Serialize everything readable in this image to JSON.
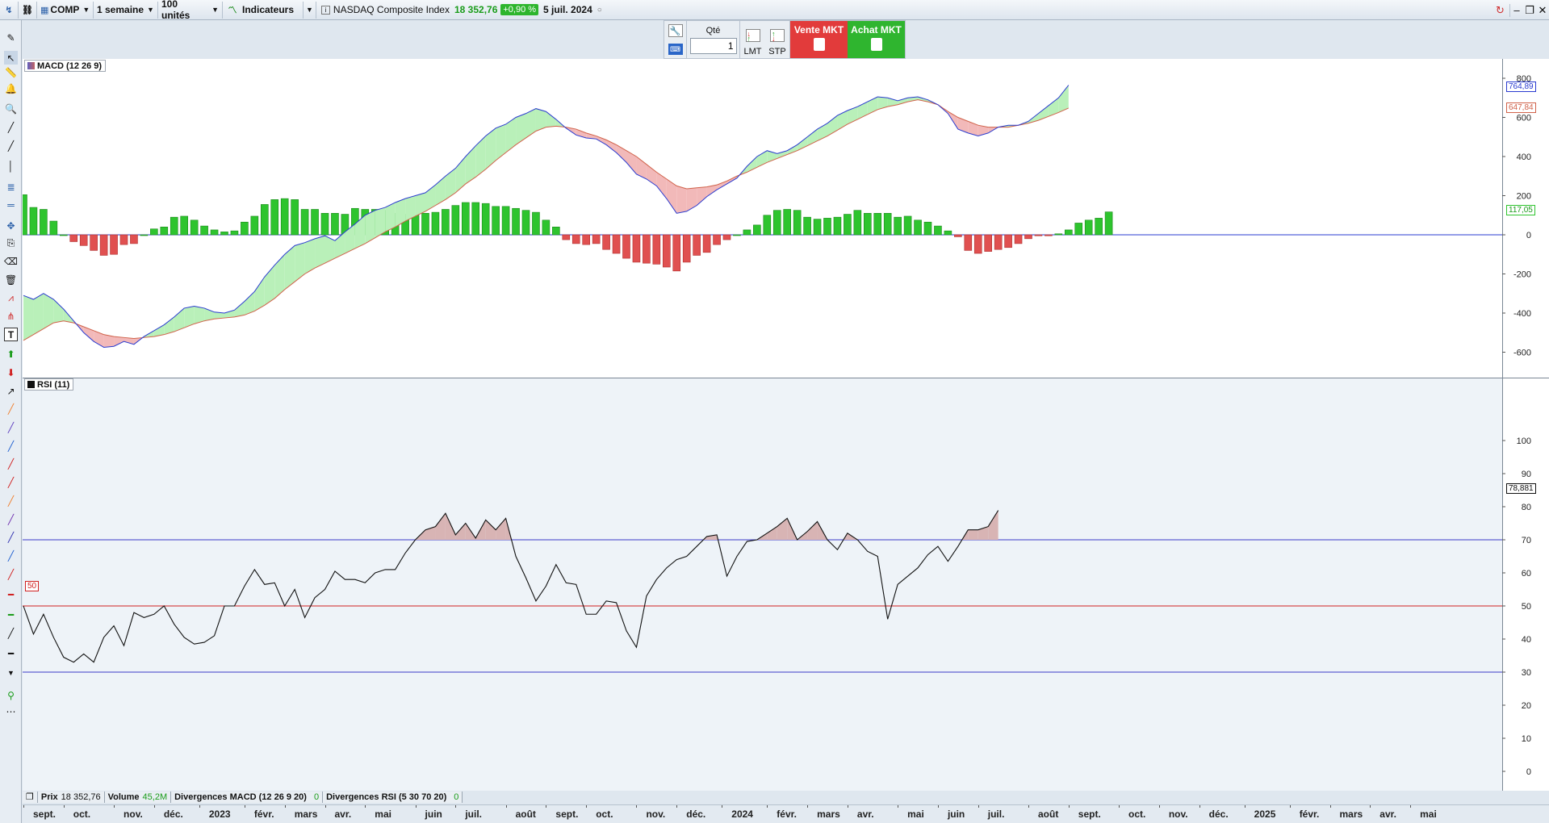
{
  "topbar": {
    "symbol": "COMP",
    "period": "1 semaine",
    "units": "100 unités",
    "indicators": "Indicateurs",
    "instrument": "NASDAQ Composite Index",
    "price": "18 352,76",
    "change": "+0,90 %",
    "date": "5 juil. 2024"
  },
  "trade": {
    "qty_label": "Qté",
    "qty_value": "1",
    "lmt": "LMT",
    "stp": "STP",
    "sell": "Vente MKT",
    "buy": "Achat MKT"
  },
  "colors": {
    "macd_line": "#2a3bd0",
    "signal_line": "#d0624a",
    "hist_pos": "#2ec42e",
    "hist_neg": "#e05050",
    "fill_pos": "#b9f0b9",
    "fill_neg": "#f2b9b9",
    "rsi_line": "#111111",
    "rsi_fill": "#d8b4b4"
  },
  "macd_panel": {
    "label": "MACD (12 26 9)",
    "macd_last": "764,89",
    "signal_last": "647,84",
    "hist_last": "117,05",
    "y_ticks": [
      "800",
      "600",
      "400",
      "200",
      "0",
      "-200",
      "-400",
      "-600"
    ],
    "y_tick_values": [
      800,
      600,
      400,
      200,
      0,
      -200,
      -400,
      -600
    ],
    "ylim": [
      -700,
      830
    ]
  },
  "rsi_panel": {
    "label": "RSI (11)",
    "rsi_last": "78,881",
    "level_50": "50",
    "y_ticks": [
      "100",
      "90",
      "80",
      "70",
      "60",
      "50",
      "40",
      "30",
      "20",
      "10",
      "0"
    ],
    "y_tick_values": [
      100,
      90,
      80,
      70,
      60,
      50,
      40,
      30,
      20,
      10,
      0
    ],
    "ylim": [
      -3,
      110
    ]
  },
  "legend": [
    {
      "label": "Prix",
      "value": "18 352,76"
    },
    {
      "label": "Volume",
      "value": "45,2M"
    },
    {
      "label": "Divergences MACD (12 26 9 20)",
      "value": "0"
    },
    {
      "label": "Divergences RSI (5 30 70 20)",
      "value": "0"
    }
  ],
  "time_axis": [
    {
      "label": "sept.",
      "x": 0
    },
    {
      "label": "oct.",
      "x": 4
    },
    {
      "label": "nov.",
      "x": 9
    },
    {
      "label": "déc.",
      "x": 13
    },
    {
      "label": "2023",
      "x": 17.5
    },
    {
      "label": "févr.",
      "x": 22
    },
    {
      "label": "mars",
      "x": 26
    },
    {
      "label": "avr.",
      "x": 30
    },
    {
      "label": "mai",
      "x": 34
    },
    {
      "label": "juin",
      "x": 39
    },
    {
      "label": "juil.",
      "x": 43
    },
    {
      "label": "août",
      "x": 48
    },
    {
      "label": "sept.",
      "x": 52
    },
    {
      "label": "oct.",
      "x": 56
    },
    {
      "label": "nov.",
      "x": 61
    },
    {
      "label": "déc.",
      "x": 65
    },
    {
      "label": "2024",
      "x": 69.5
    },
    {
      "label": "févr.",
      "x": 74
    },
    {
      "label": "mars",
      "x": 78
    },
    {
      "label": "avr.",
      "x": 82
    },
    {
      "label": "mai",
      "x": 87
    },
    {
      "label": "juin",
      "x": 91
    },
    {
      "label": "juil.",
      "x": 95
    },
    {
      "label": "août",
      "x": 100
    },
    {
      "label": "sept.",
      "x": 104
    },
    {
      "label": "oct.",
      "x": 109
    },
    {
      "label": "nov.",
      "x": 113
    },
    {
      "label": "déc.",
      "x": 117
    },
    {
      "label": "2025",
      "x": 121.5
    },
    {
      "label": "févr.",
      "x": 126
    },
    {
      "label": "mars",
      "x": 130
    },
    {
      "label": "avr.",
      "x": 134
    },
    {
      "label": "mai",
      "x": 138
    }
  ],
  "chart_data": [
    {
      "type": "line",
      "title": "MACD (12 26 9)",
      "ylim": [
        -700,
        830
      ],
      "x_unit": "weeks",
      "series": [
        {
          "name": "MACD",
          "values": [
            -310,
            -330,
            -300,
            -330,
            -380,
            -440,
            -500,
            -545,
            -575,
            -570,
            -545,
            -560,
            -520,
            -490,
            -460,
            -420,
            -375,
            -365,
            -375,
            -395,
            -400,
            -385,
            -340,
            -290,
            -215,
            -155,
            -100,
            -55,
            -40,
            -20,
            -5,
            -30,
            15,
            55,
            100,
            125,
            140,
            165,
            185,
            200,
            215,
            255,
            300,
            340,
            400,
            455,
            505,
            545,
            565,
            600,
            620,
            645,
            630,
            590,
            545,
            510,
            495,
            490,
            460,
            420,
            370,
            310,
            285,
            250,
            185,
            110,
            120,
            150,
            195,
            230,
            260,
            290,
            350,
            400,
            430,
            415,
            430,
            460,
            500,
            540,
            570,
            610,
            635,
            655,
            680,
            705,
            700,
            685,
            700,
            705,
            690,
            665,
            620,
            540,
            520,
            505,
            520,
            550,
            560,
            560,
            580,
            620,
            660,
            700,
            764.89
          ]
        },
        {
          "name": "Signal",
          "values": [
            -540,
            -510,
            -480,
            -450,
            -440,
            -450,
            -470,
            -490,
            -510,
            -520,
            -525,
            -530,
            -525,
            -520,
            -510,
            -495,
            -475,
            -455,
            -440,
            -430,
            -425,
            -420,
            -410,
            -390,
            -360,
            -325,
            -280,
            -240,
            -200,
            -170,
            -145,
            -120,
            -95,
            -70,
            -45,
            -15,
            15,
            40,
            70,
            95,
            120,
            150,
            180,
            215,
            260,
            295,
            335,
            380,
            420,
            460,
            495,
            530,
            550,
            555,
            550,
            540,
            520,
            505,
            485,
            460,
            430,
            400,
            360,
            320,
            285,
            250,
            235,
            240,
            245,
            255,
            275,
            300,
            320,
            345,
            370,
            390,
            410,
            430,
            455,
            480,
            505,
            535,
            565,
            590,
            615,
            640,
            655,
            665,
            680,
            690,
            680,
            665,
            630,
            600,
            580,
            560,
            550,
            550,
            550,
            560,
            570,
            585,
            605,
            625,
            647.84
          ]
        }
      ],
      "histogram": [
        205,
        140,
        130,
        70,
        0,
        -35,
        -55,
        -80,
        -105,
        -100,
        -50,
        -45,
        0,
        30,
        40,
        90,
        95,
        75,
        45,
        25,
        15,
        20,
        65,
        95,
        155,
        180,
        185,
        180,
        130,
        130,
        110,
        110,
        105,
        135,
        130,
        130,
        125,
        110,
        105,
        100,
        110,
        115,
        130,
        150,
        165,
        165,
        160,
        145,
        145,
        135,
        125,
        115,
        75,
        40,
        -25,
        -45,
        -50,
        -45,
        -75,
        -95,
        -120,
        -140,
        -145,
        -150,
        -165,
        -185,
        -140,
        -105,
        -90,
        -50,
        -25,
        0,
        25,
        50,
        100,
        125,
        130,
        125,
        90,
        80,
        85,
        90,
        105,
        125,
        110,
        110,
        110,
        90,
        95,
        75,
        65,
        45,
        20,
        -10,
        -80,
        -95,
        -85,
        -75,
        -65,
        -45,
        -20,
        -5,
        -5,
        5,
        25,
        60,
        75,
        85,
        117.05
      ]
    },
    {
      "type": "line",
      "title": "RSI (11)",
      "ylim": [
        0,
        100
      ],
      "x_unit": "weeks",
      "series": [
        {
          "name": "RSI",
          "values": [
            50,
            41.5,
            47.5,
            40.5,
            34.5,
            33,
            35.5,
            33,
            40.5,
            44,
            38,
            48,
            46.5,
            47.5,
            50,
            44.5,
            40.5,
            38.5,
            39,
            41,
            50,
            50,
            56,
            61,
            56.5,
            57,
            50,
            55,
            46.5,
            52.5,
            55,
            60.5,
            58,
            58,
            57,
            60,
            61,
            61,
            66,
            70,
            73,
            74,
            78,
            71.5,
            75,
            70.5,
            76,
            73,
            76.5,
            65,
            58.5,
            51.5,
            56,
            62.5,
            57,
            56.5,
            47.5,
            47.5,
            51.5,
            51,
            42.5,
            37.5,
            53,
            58,
            61.5,
            64,
            65,
            68,
            71,
            71.5,
            59,
            65,
            69.5,
            70,
            72,
            74,
            76.5,
            70,
            72.5,
            75.5,
            70,
            67,
            72,
            70,
            66.5,
            65,
            46,
            56.5,
            59,
            61.5,
            65.5,
            68,
            63.5,
            68,
            73,
            73,
            74,
            78.881
          ]
        }
      ],
      "levels": [
        70,
        50,
        30
      ]
    }
  ]
}
